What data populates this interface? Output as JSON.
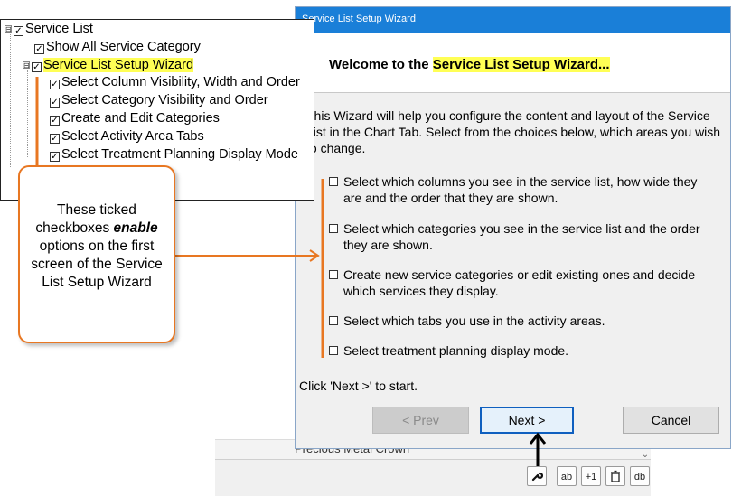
{
  "tree": {
    "items": [
      {
        "label": "Service List",
        "expander": "⊟",
        "checked": true
      },
      {
        "label": "Show All Service Category",
        "checked": true
      },
      {
        "label": "Service List Setup Wizard",
        "expander": "⊟",
        "checked": true
      },
      {
        "label": "Select Column Visibility, Width and Order",
        "checked": true
      },
      {
        "label": "Select Category Visibility and Order",
        "checked": true
      },
      {
        "label": "Create and Edit Categories",
        "checked": true
      },
      {
        "label": "Select Activity Area Tabs",
        "checked": true
      },
      {
        "label": "Select Treatment Planning Display Mode",
        "checked": true
      }
    ],
    "check_glyph": "✓"
  },
  "callout": {
    "text_before": "These ticked checkboxes",
    "emphasis": "enable",
    "text_after": "options on the first screen of the Service List Setup Wizard"
  },
  "wizard": {
    "title": "Service List Setup Wizard",
    "welcome_prefix": "Welcome to the ",
    "welcome_highlight": "Service List Setup Wizard...",
    "intro": "This Wizard will help you configure the content and layout of the Service List in the Chart Tab. Select from the choices below, which areas you wish to change.",
    "options": [
      "Select which columns you see in the service list, how wide they are and the order that they are shown.",
      "Select which categories you see in the service list and the order they are shown.",
      "Create new service categories or edit existing ones and decide which services they display.",
      "Select which tabs you use in the activity areas.",
      "Select treatment planning display mode."
    ],
    "start_text": "Click 'Next >' to start.",
    "buttons": {
      "prev": "< Prev",
      "next": "Next >",
      "cancel": "Cancel"
    }
  },
  "background": {
    "list_item": "Precious Metal Crown",
    "toolbar": {
      "btn2": "ab",
      "btn3": "+1",
      "btn5": "db"
    }
  },
  "colors": {
    "accent": "#e87722",
    "highlight": "#ffff55",
    "titlebar": "#1a7fd8"
  },
  "icons": {
    "tool": "wrench-icon",
    "delete": "trash-icon",
    "arrow": "arrow-up-icon"
  }
}
